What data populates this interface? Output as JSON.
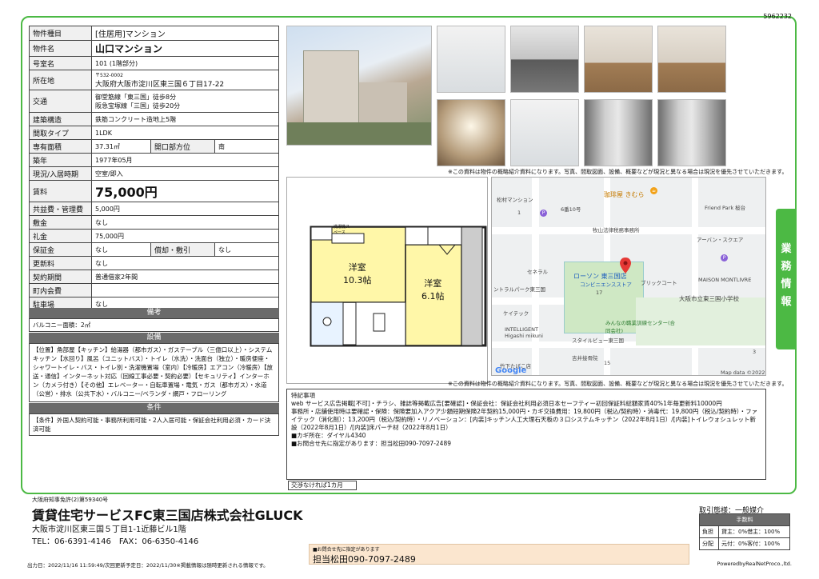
{
  "doc_id": "5962232",
  "property": {
    "type_label": "物件種目",
    "type_value": "[住居用]マンション",
    "name_label": "物件名",
    "name_value": "山口マンション",
    "room_label": "号室名",
    "room_value": "101 (1階部分)",
    "address_label": "所在地",
    "zip": "〒532-0002",
    "address": "大阪府大阪市淀川区東三国６丁目17-22",
    "transit_label": "交通",
    "transit_1": "御堂筋線「東三国」徒歩8分",
    "transit_2": "阪急宝塚線「三国」徒歩20分",
    "structure_label": "建築構造",
    "structure_value": "鉄筋コンクリート造地上5階",
    "layout_label": "間取タイプ",
    "layout_value": "1LDK",
    "area_label": "専有面積",
    "area_value": "37.31㎡",
    "direction_label": "開口部方位",
    "direction_value": "南",
    "built_label": "築年",
    "built_value": "1977年05月",
    "status_label": "現況/入居時期",
    "status_value": "空室/即入",
    "rent_label": "賃料",
    "rent_value": "75,000円",
    "common_label": "共益費・管理費",
    "common_value": "5,000円",
    "shiki_label": "敷金",
    "shiki_value": "なし",
    "rei_label": "礼金",
    "rei_value": "75,000円",
    "hosho_label": "保証金",
    "hosho_value": "なし",
    "shokyaku_label": "償却・敷引",
    "shokyaku_value": "なし",
    "renew_label": "更新料",
    "renew_value": "なし",
    "contract_label": "契約期間",
    "contract_value": "普通借家2年間",
    "town_label": "町内会費",
    "town_value": "",
    "parking_label": "駐車場",
    "parking_value": "なし"
  },
  "remarks": {
    "title": "備考",
    "text": "バルコニー面積：2㎡"
  },
  "equipment": {
    "title": "設備",
    "text": "【位置】角部屋【キッチン】給湯器（都市ガス）・ガステーブル（三億口以上）・システムキッチン【水回り】風呂（ユニットバス）・トイレ（水洗）・洗面台（独立）・暖房便座・シャワートイレ・バス・トイレ別・洗濯機置場（室内）【冷暖房】エアコン（冷暖房）【放送・通信】インターネット対応（回線工事必要・契約必要）【セキュリティ】インターホン（カメラ付き）【その他】エレベーター・自転車置場・電気・ガス（都市ガス）・水道（公営）・排水（公共下水）・バルコニー/ベランダ・網戸・フローリング"
  },
  "conditions": {
    "title": "条件",
    "text": "【条件】外国人契約可能・事務所利用可能・2人入居可能・保証会社利用必須・カード決済可能"
  },
  "photo_note": "※この資料は物件の概略紹介資料になります。写真、間取図面、設備、概要などが現況と異なる場合は現況を優先させていただきます。",
  "map_note": "※この資料は物件の概略紹介資料になります。写真、間取図面、設備、概要などが現況と異なる場合は現況を優先させていただきます。",
  "floor_plan": {
    "room1_name": "洋室",
    "room1_size": "10.3帖",
    "room2_name": "洋室",
    "room2_size": "6.1帖",
    "washer": "洗濯機スペース"
  },
  "map": {
    "labels": [
      "松村マンション",
      "珈琲屋 きむら",
      "Friend Park 桜台",
      "6番10号",
      "牧山法律税務事務所",
      "アーバン・スクエア",
      "セネラル",
      "ローソン 東三国店",
      "コンビニエンスストア",
      "ブリックコート",
      "MAISON MONTLIVRE",
      "ントラルパーク東三国",
      "大阪市立東三国小学校",
      "ケイテック",
      "みんなの職業訓練センター(合同会社)",
      "INTELLIGENT Higashi mikuni",
      "スタイルビュー東三国",
      "吉井接骨院",
      "竹下たばこ店",
      "17",
      "15",
      "1",
      "3"
    ],
    "google": "Google",
    "copyright": "Map data ©2022"
  },
  "special": {
    "title": "特記事項",
    "lines": [
      "web サービス広告掲載[不可]・チラシ、雑誌等掲載広告[要確認]・保証会社：保証会社利用必須日本セーフティー初回保証料総額家賃40%1年毎更新料10000円",
      "事務所・店舗使用時は要確認・保険：保険要加入アクア少額短期保険2年契約15,000円・カギ交換費用：19,800円（税込/契約時）・消毒代：19,800円（税込/契約時）・ファイテック（消化剤）：13,200円（税込/契約時）・リノベーション：[内装]キッチン人工大理石天板の３口システムキッチン（2022年8月1日）/[内装]トイレウォシュレット新設（2022年8月1日）/[内装]床パーチ材（2022年8月1日）",
      "■カギ所在：ダイヤル4340",
      "■お問合せ先に指定があります：担当松田090-7097-2489"
    ]
  },
  "nego": "交渉なければ1カ月",
  "side_tab": [
    "業",
    "務",
    "情",
    "報"
  ],
  "company": {
    "license": "大阪府知事免許(2)第59340号",
    "name": "賃貸住宅サービスFC東三国店株式会社GLUCK",
    "address": "大阪市淀川区東三国５丁目1-1近藤ビル1階",
    "tel": "TEL：06-6391-4146　FAX：06-6350-4146"
  },
  "contact": {
    "small": "■お問合せ先に指定があります",
    "big": "担当松田090-7097-2489"
  },
  "trade": {
    "label": "取引態様：一般媒介",
    "fee_title": "手数料",
    "burden_label": "負担",
    "burden_value": "貸主：0%借主：100%",
    "split_label": "分配",
    "split_value": "元付：0%客付：100%"
  },
  "footer": {
    "left": "出力日：2022/11/16 11:59:49/次回更新予定日：2022/11/30※掲載情報は随時更新される情報です。",
    "right": "PoweredbyRealNetProco.,ltd."
  }
}
